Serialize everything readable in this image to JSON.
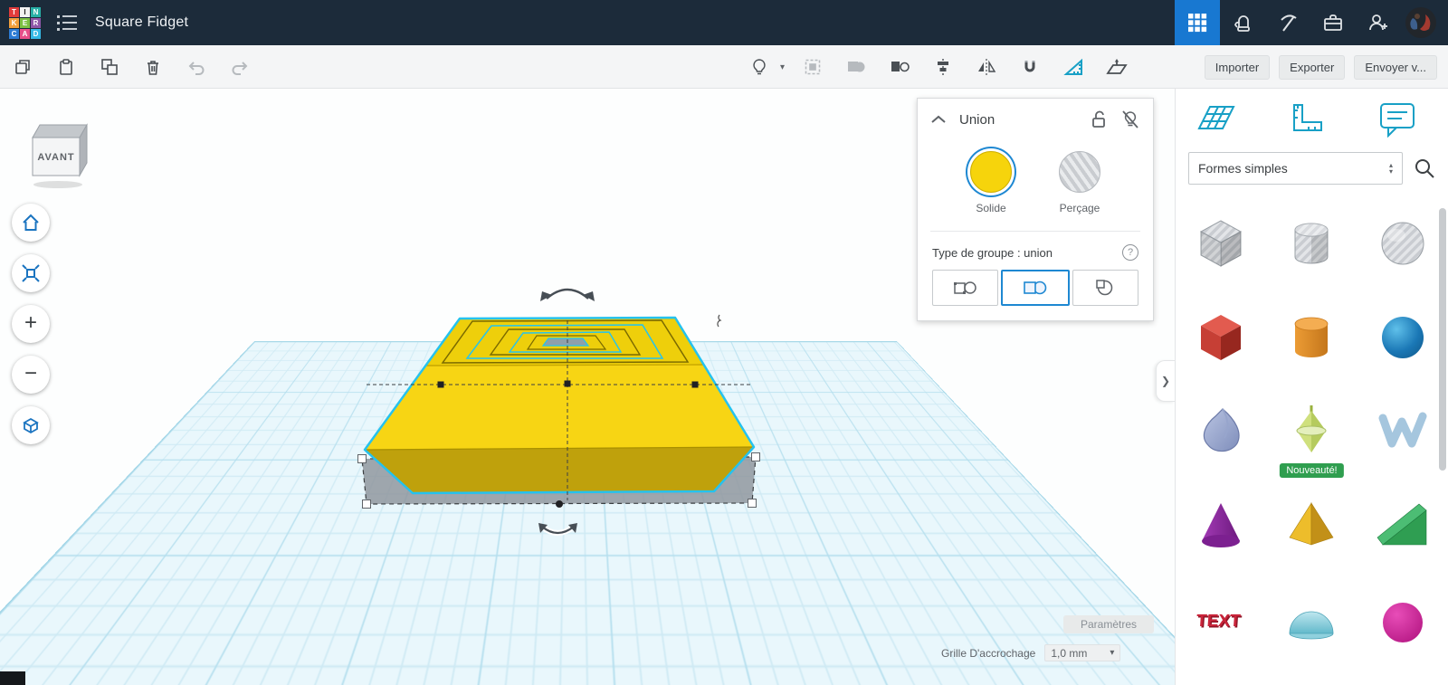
{
  "header": {
    "title": "Square Fidget",
    "logo": [
      "T",
      "I",
      "N",
      "K",
      "E",
      "R",
      "C",
      "A",
      "D"
    ],
    "logo_colors": [
      "#e23b3b",
      "#f2f2f2",
      "#28b0a6",
      "#f29f3c",
      "#7cc043",
      "#8e57a8",
      "#2c7bd3",
      "#e84f8a",
      "#35b9e6"
    ]
  },
  "toolbar": {
    "import": "Importer",
    "export": "Exporter",
    "send": "Envoyer v..."
  },
  "union_panel": {
    "title": "Union",
    "solid": "Solide",
    "hole": "Perçage",
    "group_type": "Type de groupe : union"
  },
  "sidebar": {
    "category": "Formes simples",
    "new_badge": "Nouveauté!",
    "text_shape": "TEXT",
    "shapes": [
      "box-hole",
      "cylinder-hole",
      "sphere-hole",
      "box",
      "cylinder",
      "sphere",
      "teardrop",
      "spinning-top",
      "scribble",
      "cone",
      "pyramid",
      "wedge",
      "text",
      "half-sphere",
      "torus"
    ]
  },
  "viewport": {
    "view_cube": "AVANT",
    "settings": "Paramètres",
    "snap_label": "Grille D'accrochage",
    "snap_value": "1,0 mm"
  },
  "icons": {
    "plus": "+",
    "minus": "−",
    "chevron_right": "❯",
    "caret_down": "▾",
    "caret_up": "▴",
    "help": "?"
  },
  "colors": {
    "accent_blue": "#1878D1",
    "selection_cyan": "#25C2EE",
    "solid_yellow": "#F6D40C",
    "teal": "#18A0C6",
    "header_bg": "#1C2B3A"
  }
}
